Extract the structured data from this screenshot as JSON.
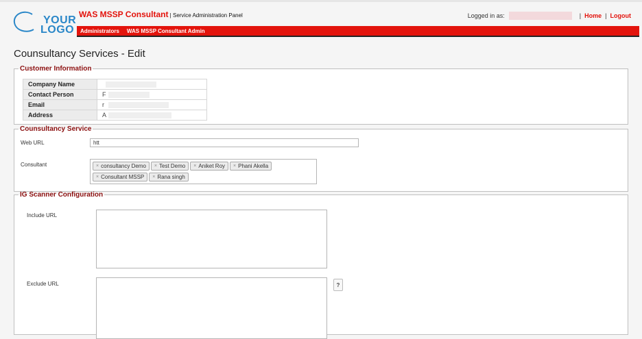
{
  "logo": {
    "line1": "YOUR",
    "line2": "LOGO"
  },
  "header": {
    "app_name": "WAS MSSP Consultant",
    "separator": " | ",
    "subtitle": "Service Administration Panel"
  },
  "userbar": {
    "logged_in_label": "Logged in as:",
    "home_link": "Home",
    "separator": "|",
    "logout_link": "Logout"
  },
  "nav": {
    "items": [
      "Administrators",
      "WAS MSSP Consultant Admin"
    ]
  },
  "page": {
    "title": "Counsultancy Services - Edit"
  },
  "customer_info": {
    "legend": "Customer Information",
    "rows": [
      {
        "label": "Company Name",
        "value": ""
      },
      {
        "label": "Contact Person",
        "value": "F"
      },
      {
        "label": "Email",
        "value": "r"
      },
      {
        "label": "Address",
        "value": "A"
      }
    ]
  },
  "service": {
    "legend": "Counsultancy Service",
    "web_url_label": "Web URL",
    "web_url_value": "htt",
    "consultant_label": "Consultant",
    "consultants": [
      "consultancy Demo",
      "Test Demo",
      "Aniket Roy",
      "Phani Akella",
      "Consultant MSSP",
      "Rana singh"
    ],
    "remove_glyph": "×"
  },
  "scanner": {
    "legend": "IG Scanner Configuration",
    "include_label": "Include URL",
    "include_value": "",
    "exclude_label": "Exclude URL",
    "exclude_value": "",
    "help_label": "?"
  },
  "colors": {
    "brand_red": "#e3140c",
    "legend_red": "#8b0f0f",
    "logo_blue": "#2a87c8"
  }
}
